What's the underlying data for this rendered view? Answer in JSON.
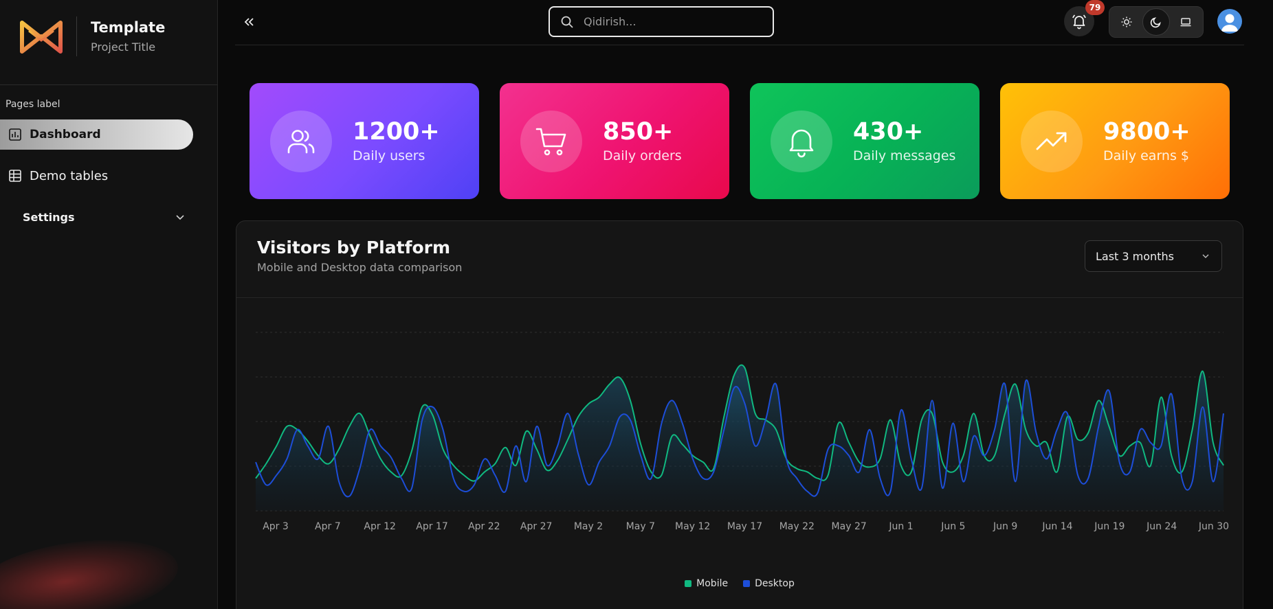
{
  "brand": {
    "title": "Template",
    "subtitle": "Project Title"
  },
  "sidebar": {
    "section_label": "Pages label",
    "items": [
      {
        "label": "Dashboard",
        "icon": "dashboard-icon",
        "active": true
      },
      {
        "label": "Demo tables",
        "icon": "table-icon",
        "active": false
      },
      {
        "label": "Settings",
        "icon": "chevron-down-icon",
        "active": false
      }
    ]
  },
  "header": {
    "search_placeholder": "Qidirish...",
    "notification_count": "79",
    "theme_options": [
      "light",
      "dark",
      "system"
    ],
    "theme_selected": "dark"
  },
  "stats": [
    {
      "value": "1200+",
      "label": "Daily users",
      "icon": "users-icon"
    },
    {
      "value": "850+",
      "label": "Daily orders",
      "icon": "cart-icon"
    },
    {
      "value": "430+",
      "label": "Daily messages",
      "icon": "bell-icon"
    },
    {
      "value": "9800+",
      "label": "Daily earns $",
      "icon": "trending-up-icon"
    }
  ],
  "panel": {
    "title": "Visitors by Platform",
    "subtitle": "Mobile and Desktop data comparison",
    "range_selected": "Last 3 months"
  },
  "chart_data": {
    "type": "area",
    "title": "Visitors by Platform",
    "x_start": "Apr 3",
    "x_end": "Jun 30",
    "tick_labels": [
      "Apr 3",
      "Apr 7",
      "Apr 12",
      "Apr 17",
      "Apr 22",
      "Apr 27",
      "May 2",
      "May 7",
      "May 12",
      "May 17",
      "May 22",
      "May 27",
      "Jun 1",
      "Jun 5",
      "Jun 9",
      "Jun 14",
      "Jun 19",
      "Jun 24",
      "Jun 30"
    ],
    "ylim": [
      0,
      550
    ],
    "grid": true,
    "legend_position": "bottom",
    "series": [
      {
        "name": "Mobile",
        "color": "#10b981",
        "values": [
          100,
          145,
          200,
          260,
          250,
          215,
          170,
          145,
          190,
          260,
          300,
          230,
          160,
          120,
          108,
          185,
          320,
          295,
          190,
          140,
          110,
          92,
          120,
          145,
          195,
          140,
          245,
          190,
          125,
          155,
          220,
          290,
          330,
          350,
          390,
          410,
          340,
          205,
          120,
          110,
          230,
          205,
          170,
          150,
          130,
          290,
          420,
          440,
          300,
          280,
          250,
          160,
          130,
          120,
          100,
          110,
          270,
          210,
          150,
          135,
          160,
          280,
          140,
          120,
          280,
          300,
          150,
          120,
          170,
          300,
          170,
          170,
          300,
          390,
          250,
          200,
          210,
          120,
          290,
          220,
          240,
          340,
          260,
          170,
          200,
          210,
          140,
          350,
          170,
          120,
          250,
          430,
          210,
          140
        ]
      },
      {
        "name": "Desktop",
        "color": "#1d4ed8",
        "values": [
          150,
          80,
          110,
          160,
          250,
          200,
          160,
          260,
          90,
          45,
          130,
          250,
          200,
          165,
          100,
          70,
          280,
          320,
          250,
          100,
          60,
          80,
          160,
          110,
          60,
          200,
          90,
          260,
          140,
          200,
          300,
          175,
          80,
          150,
          200,
          290,
          280,
          170,
          100,
          270,
          340,
          270,
          160,
          100,
          120,
          250,
          380,
          330,
          200,
          280,
          390,
          160,
          100,
          60,
          55,
          190,
          200,
          170,
          120,
          250,
          100,
          60,
          310,
          160,
          70,
          340,
          70,
          270,
          90,
          230,
          170,
          250,
          390,
          90,
          400,
          240,
          160,
          250,
          300,
          110,
          100,
          260,
          370,
          150,
          120,
          250,
          210,
          200,
          360,
          100,
          90,
          320,
          90,
          300
        ]
      }
    ]
  }
}
